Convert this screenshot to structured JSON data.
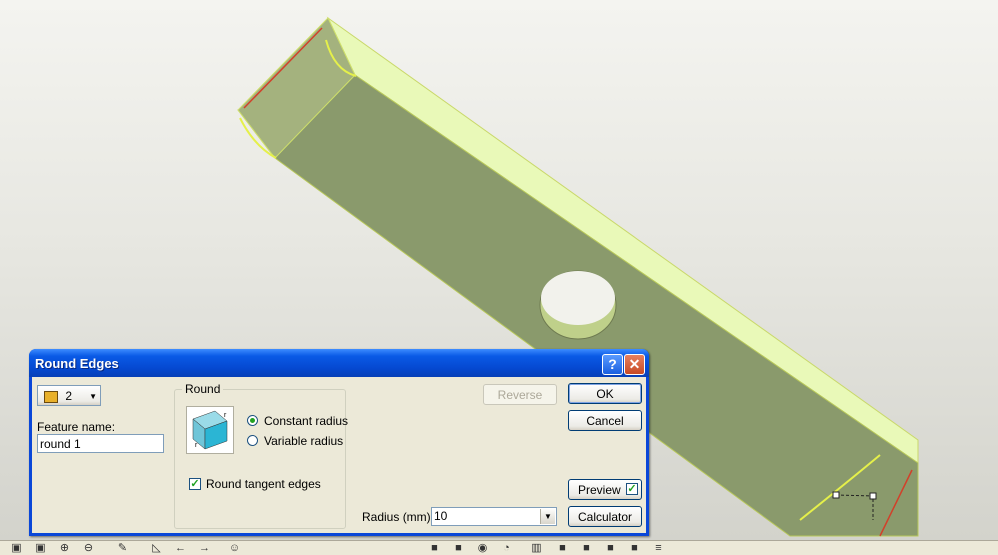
{
  "dialog": {
    "title": "Round Edges",
    "help_label": "?",
    "close_label": "✕",
    "edge_count": "2",
    "feature_name_label": "Feature name:",
    "feature_name_value": "round 1",
    "round_group_label": "Round",
    "constant_radius_label": "Constant radius",
    "variable_radius_label": "Variable radius",
    "round_tangent_label": "Round tangent edges",
    "reverse_label": "Reverse",
    "ok_label": "OK",
    "cancel_label": "Cancel",
    "preview_label": "Preview",
    "calculator_label": "Calculator",
    "radius_label": "Radius (mm):",
    "radius_value": "10",
    "constant_radius_selected": true,
    "round_tangent_checked": true,
    "preview_checked": true
  },
  "icons": [
    "edge-select-icon",
    "round-preview-icon",
    "zoom-fit-icon",
    "zoom-window-icon",
    "zoom-in-icon",
    "zoom-out-icon",
    "sketch-icon",
    "back-arrow-icon",
    "forward-arrow-icon",
    "face-icon",
    "view-cube-icons"
  ],
  "colors": {
    "model_top": "#e6f8b0",
    "model_face": "#8a9a6c",
    "title_blue": "#0a47d8",
    "dialog_face": "#ece9d8"
  }
}
